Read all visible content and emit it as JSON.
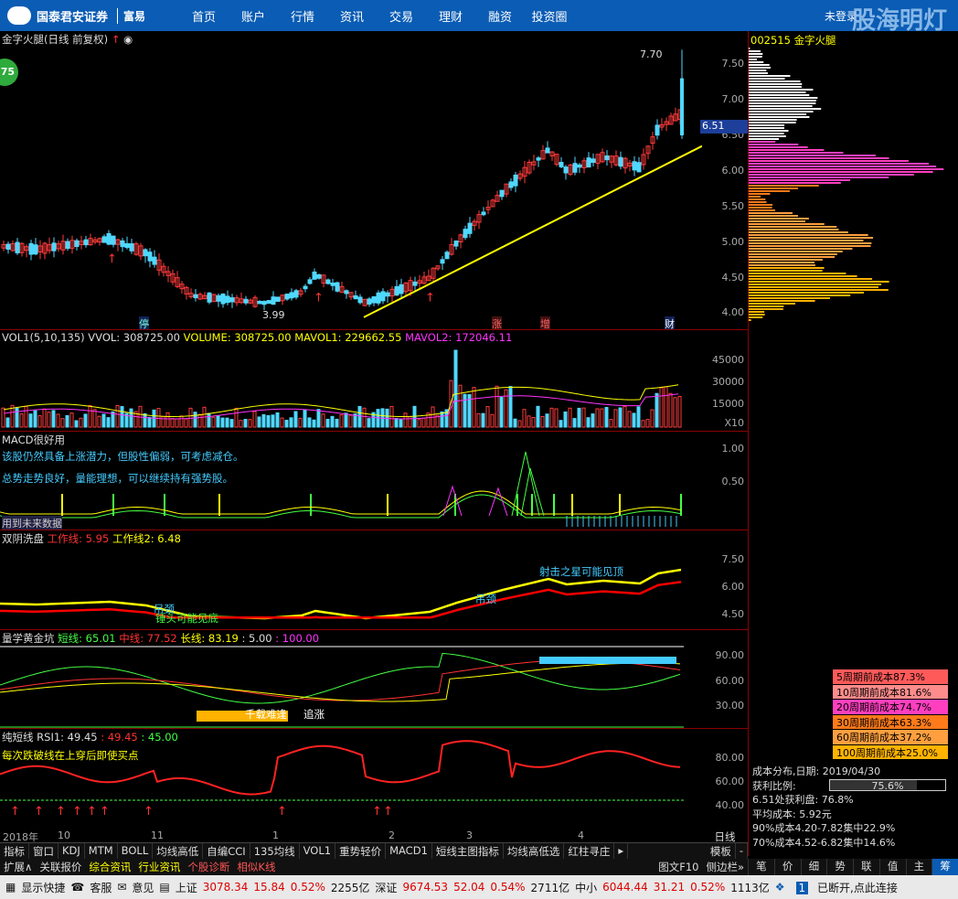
{
  "brand": {
    "name": "国泰君安证券",
    "sub": "富易"
  },
  "nav": [
    "首页",
    "账户",
    "行情",
    "资讯",
    "交易",
    "理财",
    "融资",
    "投资圈"
  ],
  "login_label": "未登录",
  "watermark": "股海明灯",
  "main_title": "金字火腿(日线 前复权)",
  "badge": "75",
  "price_high_label": "7.70",
  "price_low_label": "3.99",
  "current_price": "6.51",
  "price_ticks": [
    "7.50",
    "7.00",
    "6.50",
    "6.00",
    "5.50",
    "5.00",
    "4.50",
    "4.00"
  ],
  "event_marks": [
    "停",
    "涨",
    "增",
    "财"
  ],
  "vol": {
    "title": "VOL1(5,10,135)",
    "vvol": "VVOL: 308725.00",
    "volume": "VOLUME: 308725.00",
    "mavol1": "MAVOL1: 229662.55",
    "mavol2": "MAVOL2: 172046.11",
    "ticks": [
      "45000",
      "30000",
      "15000"
    ],
    "scale": "X10"
  },
  "macd": {
    "title": "MACD很好用",
    "line1": "该股仍然具备上涨潜力，但股性偏弱，可考虑减仓。",
    "line2": "总势走势良好，量能理想，可以继续持有强势股。",
    "footer": "用到未来数据",
    "ticks": [
      "1.00",
      "0.50"
    ]
  },
  "sy": {
    "title": "双阴洗盘",
    "w1": "工作线: 5.95",
    "w2": "工作线2: 6.48",
    "ticks": [
      "7.50",
      "6.00",
      "4.50"
    ],
    "labels": [
      "锤头可能见底",
      "吊颈",
      "射击之星可能见顶",
      "吊颈"
    ]
  },
  "lx": {
    "title": "量学黄金坑",
    "s": "短线: 65.01",
    "m": "中线: 77.52",
    "l": "长线: 83.19",
    "p": ": 5.00",
    "q": ": 100.00",
    "ticks": [
      "90.00",
      "60.00",
      "30.00"
    ],
    "labels": [
      "千载难逢",
      "追涨"
    ]
  },
  "rsi": {
    "title": "纯短线",
    "rsi1": "RSI1: 49.45",
    "a": ": 49.45",
    "b": ": 45.00",
    "hint": "每次跌破线在上穿后即使买点",
    "ticks": [
      "80.00",
      "60.00",
      "40.00"
    ]
  },
  "xaxis": [
    "2018年",
    "10",
    "11",
    "1",
    "2",
    "3",
    "4"
  ],
  "right": {
    "code": "002515",
    "name": "金字火腿"
  },
  "cost_legend": [
    {
      "label": "5周期前成本87.3%",
      "color": "#ff5a5a"
    },
    {
      "label": "10周期前成本81.6%",
      "color": "#ff8c8c"
    },
    {
      "label": "20周期前成本74.7%",
      "color": "#ff3fbf"
    },
    {
      "label": "30周期前成本63.3%",
      "color": "#ff7a1a"
    },
    {
      "label": "60周期前成本37.2%",
      "color": "#ff9f3f"
    },
    {
      "label": "100周期前成本25.0%",
      "color": "#ffb300"
    }
  ],
  "stats": [
    "成本分布,日期: 2019/04/30",
    "获利比例:",
    "6.51处获利盘: 76.8%",
    "平均成本: 5.92元",
    "90%成本4.20-7.82集中22.9%",
    "70%成本4.52-6.82集中14.6%"
  ],
  "profit_ratio": "75.6%",
  "tabs": [
    "指标",
    "窗口",
    "KDJ",
    "MTM",
    "BOLL",
    "均线高低",
    "自编CCI",
    "135均线",
    "VOL1",
    "重势轻价",
    "MACD1",
    "短线主图指标",
    "均线高低选",
    "红柱寻庄"
  ],
  "tabs_right": [
    "模板",
    "-"
  ],
  "period": "日线",
  "tabs2": [
    "扩展∧",
    "关联报价",
    "综合资讯",
    "行业资讯",
    "个股诊断",
    "相似K线"
  ],
  "tabs2_right": [
    "图文F10",
    "侧边栏»"
  ],
  "rtabs": [
    "笔",
    "价",
    "细",
    "势",
    "联",
    "值",
    "主",
    "筹"
  ],
  "status": {
    "show": "显示快捷",
    "svc": "客服",
    "opinion": "意见",
    "sh": "上证",
    "sh_v": "3078.34",
    "sh_c": "15.84",
    "sh_p": "0.52%",
    "sh_a": "2255亿",
    "sz": "深证",
    "sz_v": "9674.53",
    "sz_c": "52.04",
    "sz_p": "0.54%",
    "sz_a": "2711亿",
    "zx": "中小",
    "zx_v": "6044.44",
    "zx_c": "31.21",
    "zx_p": "0.52%",
    "zx_a": "1113亿",
    "conn": "已断开,点此连接"
  }
}
